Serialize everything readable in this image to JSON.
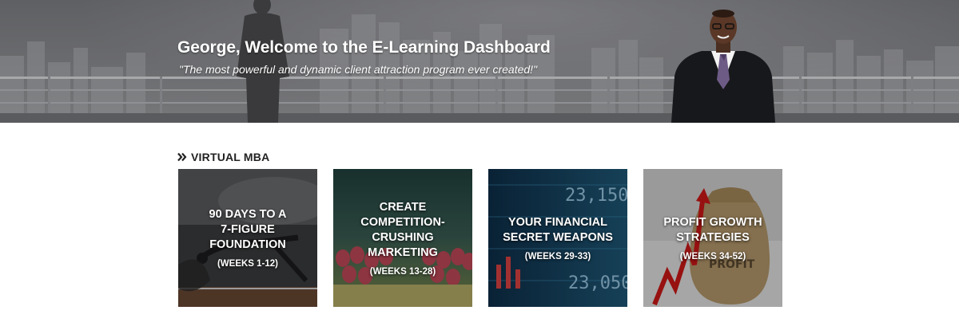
{
  "hero": {
    "title": "George, Welcome to the E-Learning Dashboard",
    "quote": "\"The most powerful and dynamic client attraction program ever created!\""
  },
  "section": {
    "heading": "VIRTUAL MBA",
    "icon": "double-chevron-right-icon"
  },
  "cards": [
    {
      "title_lines": [
        "90 DAYS TO A",
        "7-FIGURE",
        "FOUNDATION"
      ],
      "subtitle": "(WEEKS 1-12)",
      "image": "hurdle-runner-image"
    },
    {
      "title_lines": [
        "CREATE",
        "COMPETITION-",
        "CRUSHING",
        "MARKETING"
      ],
      "subtitle": "(WEEKS 13-28)",
      "image": "matches-image"
    },
    {
      "title_lines": [
        "YOUR FINANCIAL",
        "SECRET WEAPONS"
      ],
      "subtitle": "(WEEKS 29-33)",
      "image": "stock-ticker-image",
      "background_text": [
        "23,150",
        "23,050"
      ]
    },
    {
      "title_lines": [
        "PROFIT GROWTH",
        "STRATEGIES"
      ],
      "subtitle": "(WEEKS 34-52)",
      "image": "profit-sack-image",
      "background_text": [
        "PROFIT"
      ]
    }
  ],
  "colors": {
    "hero_bg": "#6b6c6f",
    "heading_text": "#222222",
    "card_text": "#ffffff"
  }
}
